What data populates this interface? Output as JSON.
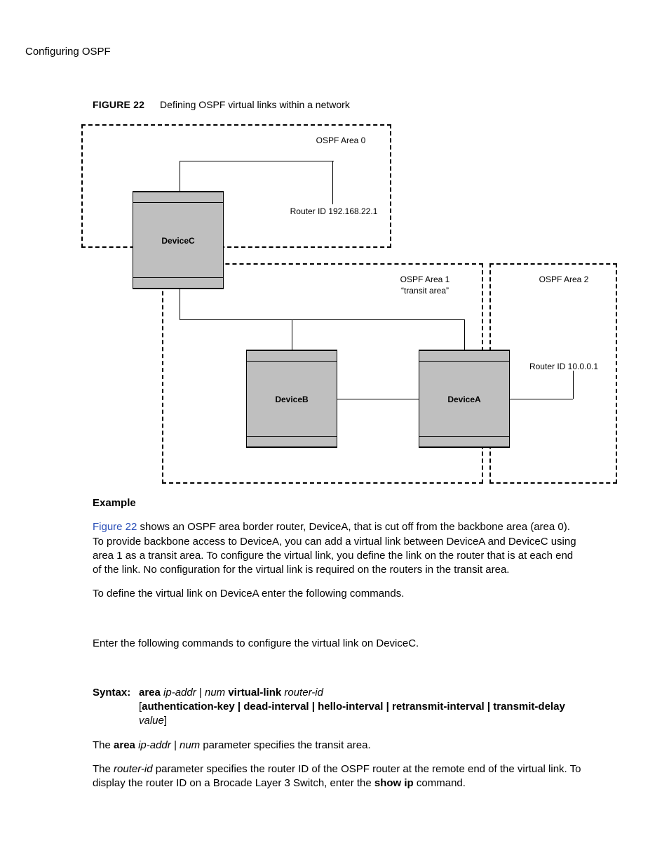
{
  "header": {
    "running": "Configuring OSPF"
  },
  "figure": {
    "label": "FIGURE 22",
    "caption": "Defining OSPF virtual links within a network"
  },
  "diagram": {
    "area0": "OSPF Area 0",
    "area1_line1": "OSPF Area 1",
    "area1_line2": "“transit area”",
    "area2": "OSPF Area 2",
    "router_c_id": "Router ID 192.168.22.1",
    "router_a_id": "Router ID 10.0.0.1",
    "dev_c": "DeviceC",
    "dev_b": "DeviceB",
    "dev_a": "DeviceA"
  },
  "body": {
    "example_hdr": "Example",
    "link": "Figure 22",
    "p1_rest": " shows an OSPF area border router, DeviceA, that is cut off from the backbone area (area 0).  To provide backbone access to DeviceA, you can add a virtual link between DeviceA and DeviceC using area 1 as a transit area.  To configure the virtual link, you define the link on the router that is at each end of the link.  No configuration for the virtual link is required on the routers in the transit area.",
    "p2": "To define the virtual link on DeviceA enter the following commands.",
    "p3": "Enter the following commands to configure the virtual link on DeviceC."
  },
  "syntax": {
    "label": "Syntax:",
    "l1_bold_a": "area",
    "l1_it_a": "ip-addr",
    "l1_pipe": " | ",
    "l1_it_b": "num",
    "l1_bold_b": "virtual-link",
    "l1_it_c": "router-id",
    "l2_open": "[",
    "l2_bold": "authentication-key | dead-interval | hello-interval | retransmit-interval | transmit-delay",
    "l3_it": "value",
    "l3_close": "]"
  },
  "trailing": {
    "p1_a": "The ",
    "p1_bold": "area",
    "p1_b": " ",
    "p1_it": "ip-addr | num",
    "p1_c": " parameter specifies the transit area.",
    "p2_a": "The ",
    "p2_it": "router-id",
    "p2_b": " parameter specifies the router ID of the OSPF router at the remote end of the virtual link.  To display the router ID on a Brocade Layer 3 Switch, enter the ",
    "p2_bold": "show ip",
    "p2_c": " command."
  }
}
